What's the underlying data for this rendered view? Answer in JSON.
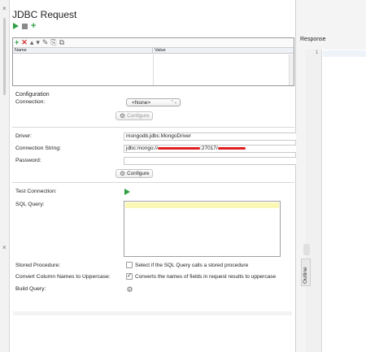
{
  "gutter": {
    "close_top": "×",
    "close_bottom": "×"
  },
  "header": {
    "title": "JDBC Request"
  },
  "run_toolbar": {
    "run_icon": "play-icon",
    "stop_icon": "stop-icon",
    "add_icon": "plus-icon"
  },
  "param_table": {
    "tools": [
      "+",
      "✕",
      "▴",
      "▾",
      "✎",
      "⎘",
      "⧉"
    ],
    "columns": [
      "Name",
      "Value"
    ]
  },
  "configuration": {
    "heading": "Configuration",
    "connection_label": "Connection:",
    "connection_value": "<None>",
    "connection_arrow": "⌃⌄",
    "configure_label": "Configure"
  },
  "driver": {
    "driver_label": "Driver:",
    "driver_value": "mongodb.jdbc.MongoDriver",
    "conn_string_label": "Connection String:",
    "conn_string_prefix": "jdbc:mongo://",
    "conn_string_mid": ":27017/",
    "password_label": "Password:",
    "password_value": "",
    "configure_label": "Configure"
  },
  "query": {
    "test_connection_label": "Test Connection:",
    "sql_query_label": "SQL Query:",
    "stored_procedure_label": "Stored Procedure:",
    "stored_procedure_text": "Select if the SQL Query calls a stored procedure",
    "stored_procedure_checked": false,
    "uppercase_label": "Convert Column Names to Uppercase:",
    "uppercase_text": "Converts the names of fields in request results to uppercase",
    "uppercase_checked": true,
    "uppercase_check_glyph": "✓",
    "build_query_label": "Build Query:"
  },
  "response": {
    "title": "Response",
    "line_number": "1",
    "outline_tab": "Outline"
  },
  "colors": {
    "accent_green": "#2ea043",
    "delete_red": "#d32f2f",
    "highlight_yellow": "#fbf7b4"
  }
}
